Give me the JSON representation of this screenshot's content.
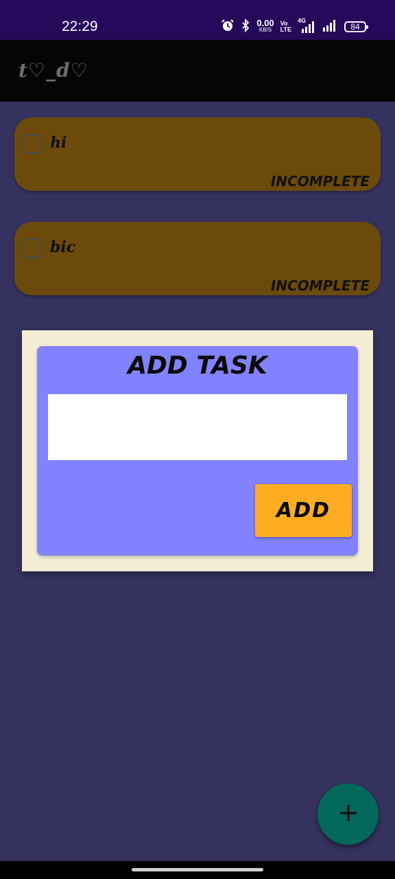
{
  "status_bar": {
    "time": "22:29",
    "net_speed_value": "0.00",
    "net_speed_unit": "KB/S",
    "volte_top": "Vo",
    "volte_bottom": "LTE",
    "network_type": "4G",
    "battery": "84",
    "icons": [
      "alarm-icon",
      "bluetooth-icon",
      "signal-icon",
      "signal-icon"
    ]
  },
  "app_bar": {
    "title": "t♡_d♡"
  },
  "tasks": [
    {
      "text": "hi",
      "status": "INCOMPLETE",
      "checked": false
    },
    {
      "text": "bic",
      "status": "INCOMPLETE",
      "checked": false
    }
  ],
  "dialog": {
    "title": "ADD TASK",
    "input_value": "",
    "input_placeholder": "",
    "add_label": "ADD"
  },
  "fab": {
    "icon": "plus-icon",
    "label": "+"
  },
  "colors": {
    "status_bar_bg": "#26095a",
    "app_bar_bg": "#050505",
    "page_bg": "#35325f",
    "task_card_bg": "#6b4a0c",
    "dialog_outer_bg": "#f2edd3",
    "dialog_inner_bg": "#8281fe",
    "add_button_bg": "#fead23",
    "fab_bg": "#00695c"
  }
}
